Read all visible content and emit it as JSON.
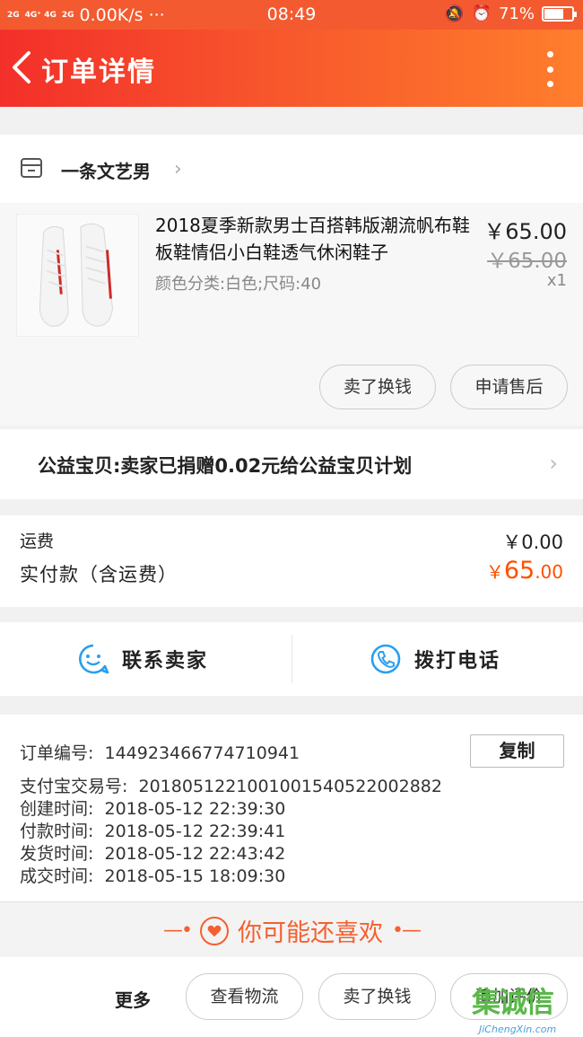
{
  "status_bar": {
    "signal_1": "2G",
    "signal_2": "4G⁺ 4G",
    "signal_3": "2G",
    "speed": "0.00K/s ···",
    "time": "08:49",
    "battery": "71%",
    "battery_level": 0.71
  },
  "header": {
    "title": "订单详情"
  },
  "shop": {
    "name": "一条文艺男"
  },
  "item": {
    "title": "2018夏季新款男士百搭韩版潮流帆布鞋板鞋情侣小白鞋透气休闲鞋子",
    "sku": "颜色分类:白色;尺码:40",
    "price": "￥65.00",
    "original_price": "￥65.00",
    "quantity": "x1",
    "actions": [
      "卖了换钱",
      "申请售后"
    ]
  },
  "charity": {
    "text": "公益宝贝:卖家已捐赠0.02元给公益宝贝计划"
  },
  "fees": {
    "shipping_label": "运费",
    "shipping_value": "￥0.00",
    "paid_label": "实付款（含运费）",
    "paid_currency": "￥",
    "paid_int": "65",
    "paid_dec": ".00"
  },
  "contact": {
    "seller": "联系卖家",
    "call": "拨打电话"
  },
  "order_info": {
    "copy_label": "复制",
    "rows": [
      {
        "k": "订单编号:",
        "v": "144923466774710941"
      },
      {
        "k": "支付宝交易号:",
        "v": "2018051221001001540522002882"
      },
      {
        "k": "创建时间:",
        "v": "2018-05-12 22:39:30"
      },
      {
        "k": "付款时间:",
        "v": "2018-05-12 22:39:41"
      },
      {
        "k": "发货时间:",
        "v": "2018-05-12 22:43:42"
      },
      {
        "k": "成交时间:",
        "v": "2018-05-15 18:09:30"
      }
    ]
  },
  "recommend": {
    "title": "你可能还喜欢"
  },
  "bottom_bar": {
    "more": "更多",
    "buttons": [
      "查看物流",
      "卖了换钱",
      "追加评价"
    ]
  },
  "watermark": {
    "logo": "集诚信",
    "url": "JiChengXin.com"
  },
  "colors": {
    "accent": "#f45a2f",
    "price_orange": "#ff5000",
    "contact_blue": "#2a9ff0"
  }
}
